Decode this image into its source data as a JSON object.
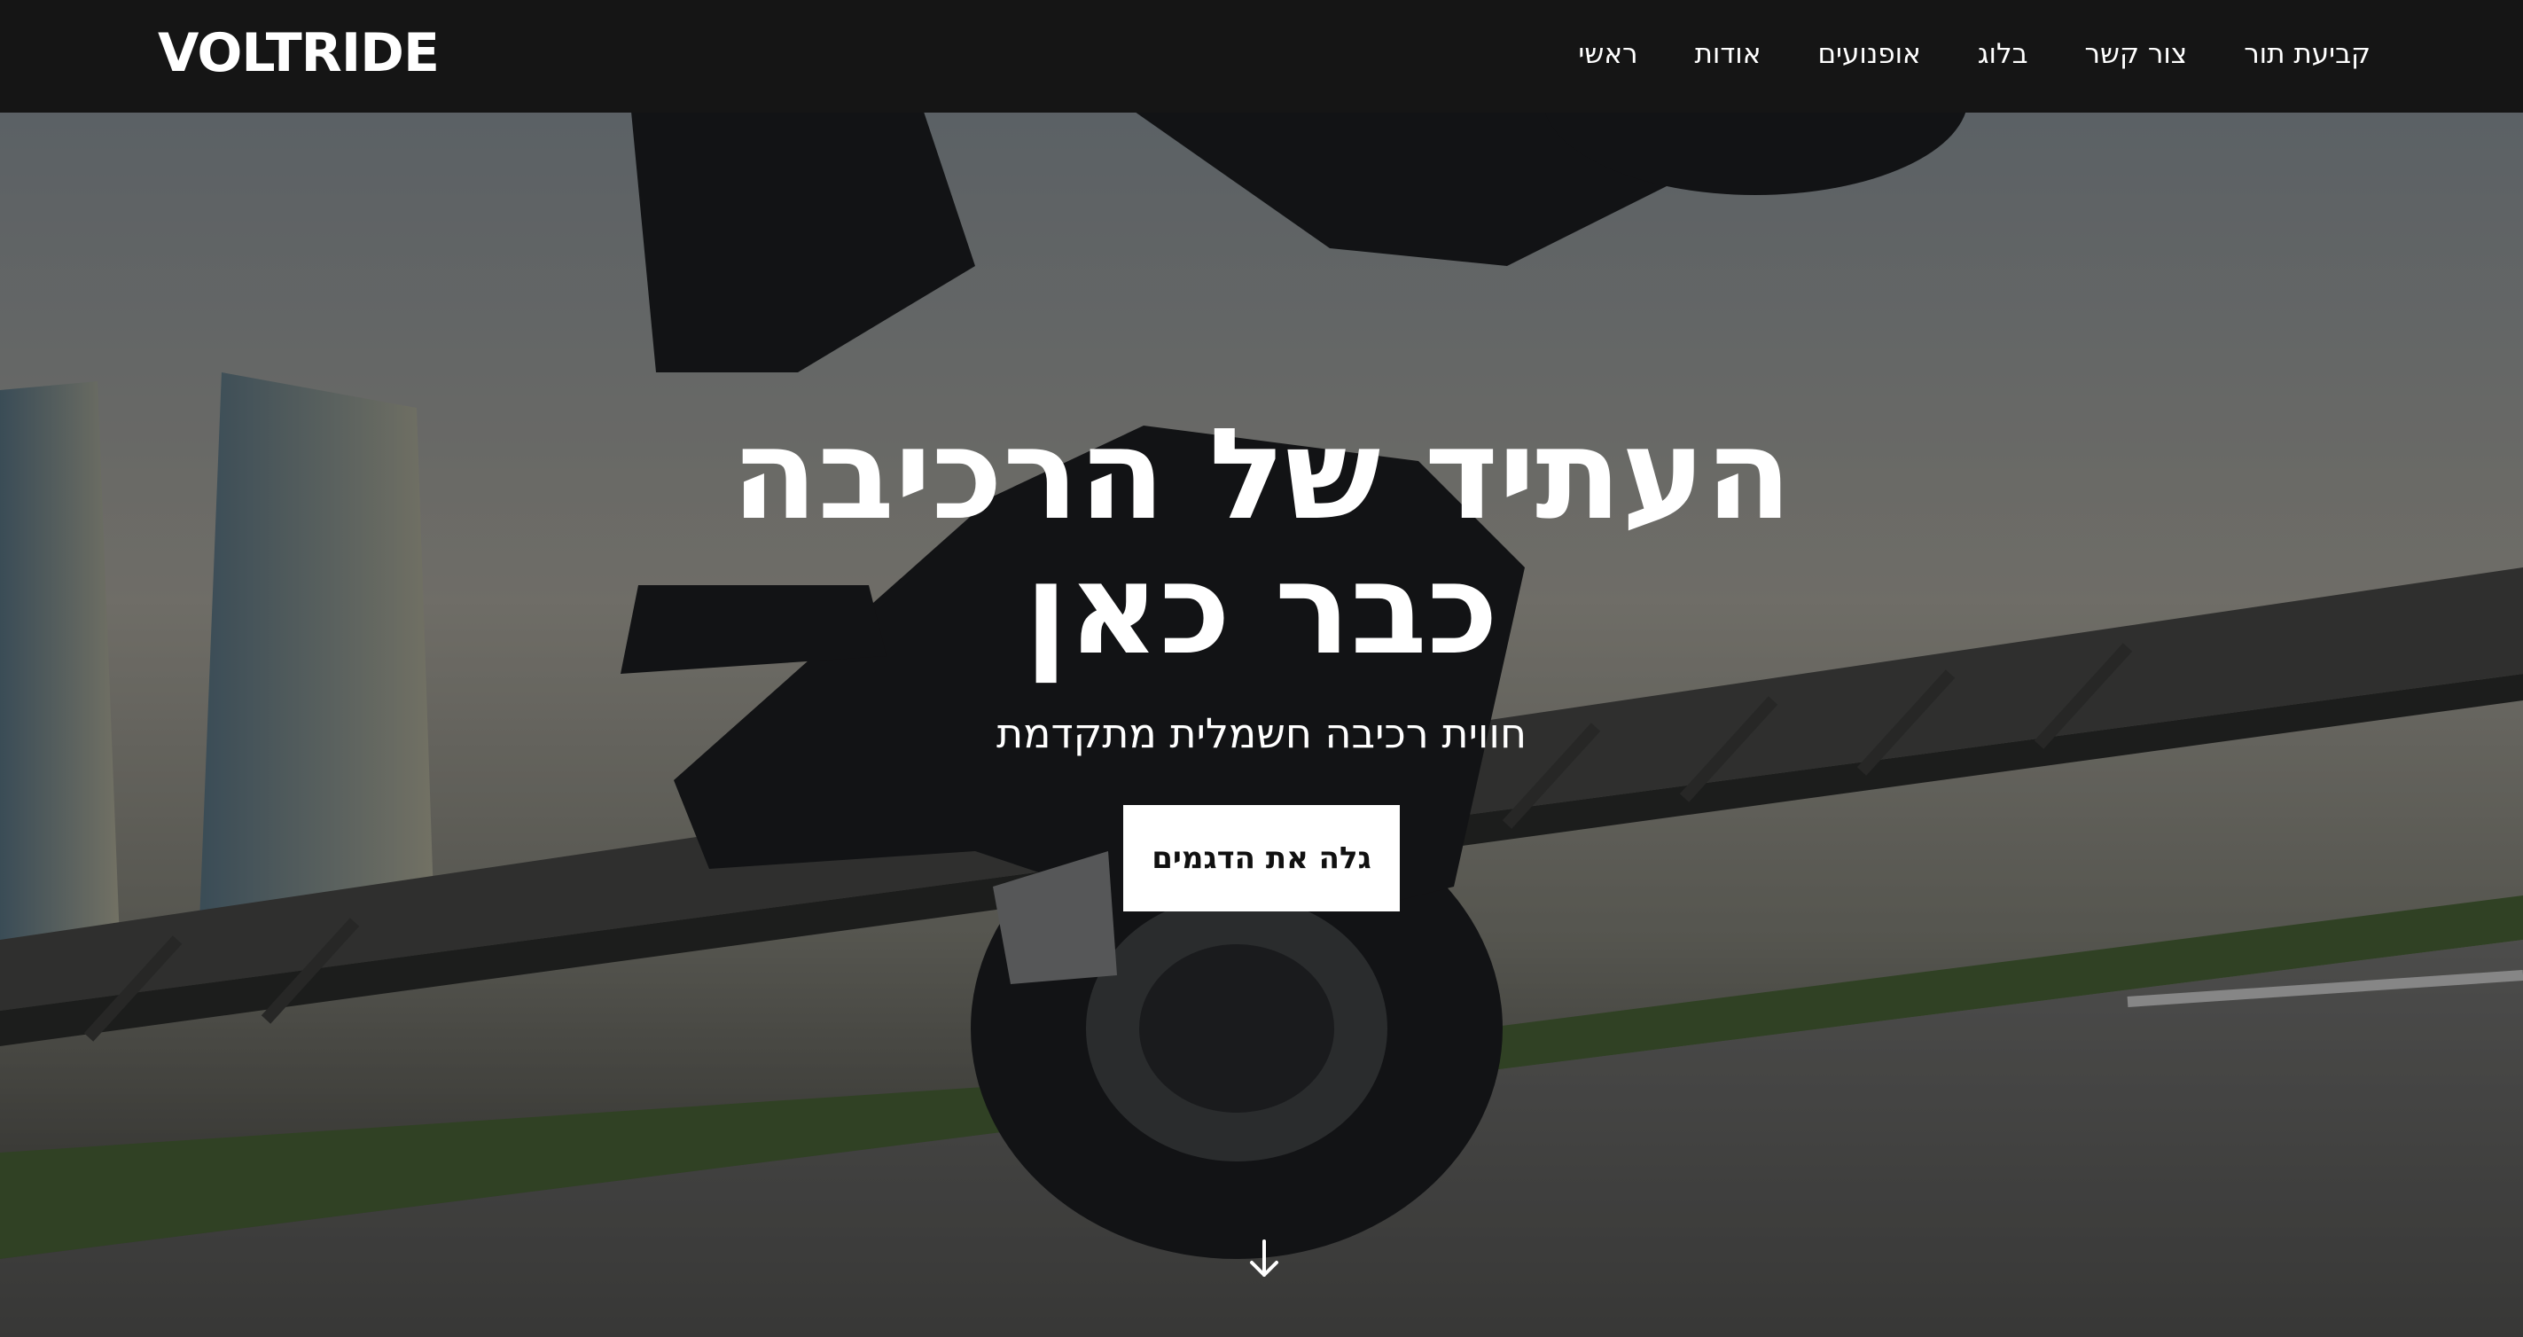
{
  "brand": {
    "logo_text": "VOLTRIDE"
  },
  "nav": {
    "items": [
      {
        "label": "ראשי"
      },
      {
        "label": "אודות"
      },
      {
        "label": "אופנועים"
      },
      {
        "label": "בלוג"
      },
      {
        "label": "צור קשר"
      },
      {
        "label": "קביעת תור"
      }
    ]
  },
  "hero": {
    "title": "העתיד של הרכיבה כבר כאן",
    "subtitle": "חווית רכיבה חשמלית מתקדמת",
    "cta_label": "גלה את הדגמים",
    "scroll_icon": "arrow-down-icon"
  },
  "colors": {
    "navbar_bg": "#151515",
    "cta_bg": "#ffffff",
    "text": "#ffffff"
  }
}
